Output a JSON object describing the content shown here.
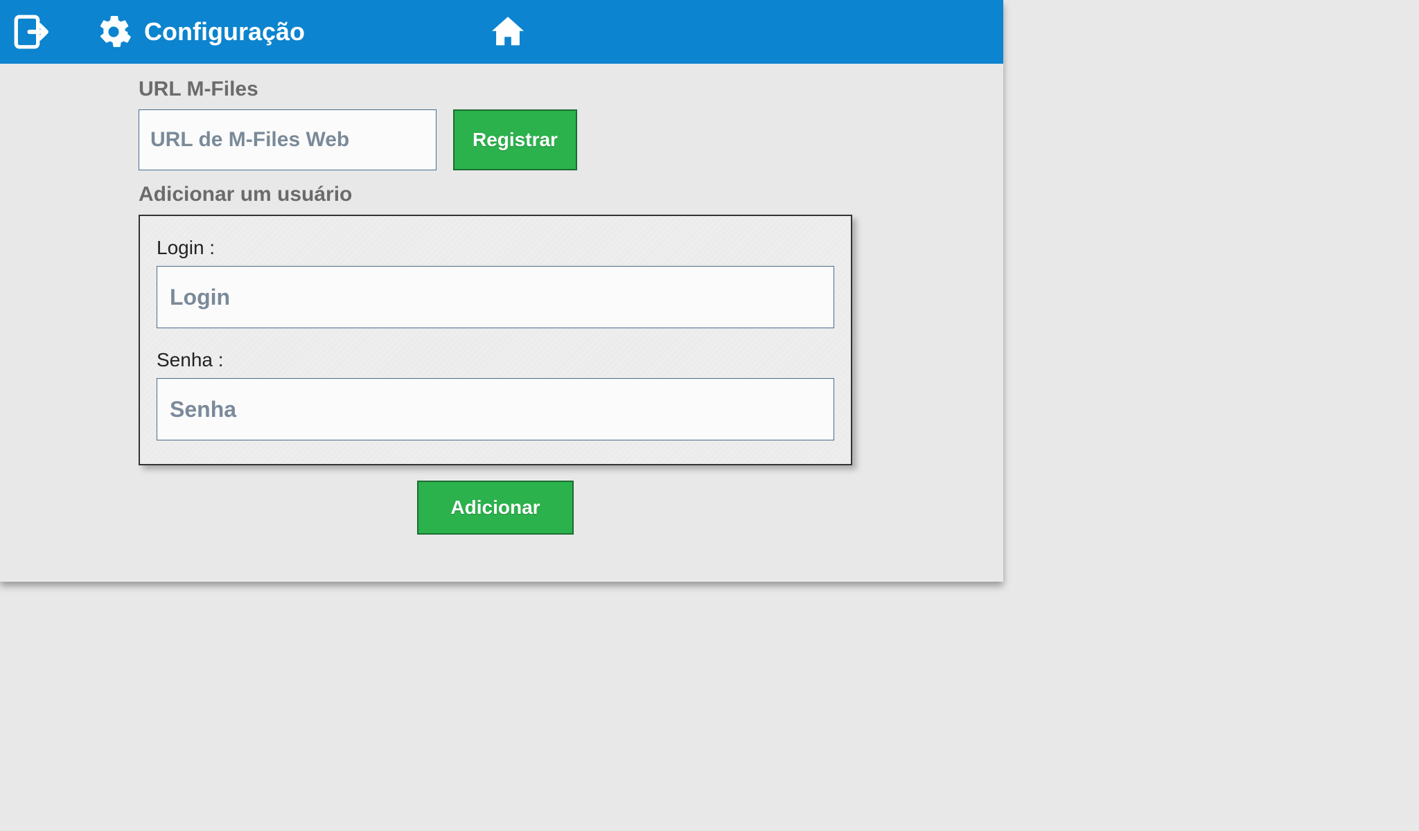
{
  "header": {
    "title": "Configuração"
  },
  "url_section": {
    "label": "URL M-Files",
    "placeholder": "URL de M-Files Web",
    "register_button": "Registrar"
  },
  "user_section": {
    "label": "Adicionar um usuário",
    "login_label": "Login :",
    "login_placeholder": "Login",
    "password_label": "Senha :",
    "password_placeholder": "Senha",
    "add_button": "Adicionar"
  }
}
